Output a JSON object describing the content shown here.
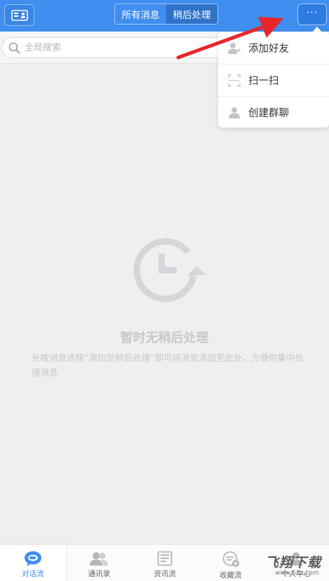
{
  "header": {
    "segments": [
      "所有消息",
      "稍后处理"
    ],
    "active_segment": "稍后处理",
    "more_label": "···"
  },
  "search": {
    "placeholder": "全局搜索"
  },
  "dropdown_menu": {
    "items": [
      {
        "label": "添加好友",
        "icon": "add-user-icon"
      },
      {
        "label": "扫一扫",
        "icon": "scan-icon"
      },
      {
        "label": "创建群聊",
        "icon": "group-chat-icon"
      }
    ]
  },
  "empty_state": {
    "icon": "clock-later-icon",
    "title": "暂时无稍后处理",
    "description": "长按消息选择“添加至稍后处理”即可将消息添加至此处，方便你集中处理消息"
  },
  "tabbar": {
    "active": "对话流",
    "items": [
      {
        "label": "对话流",
        "icon": "chat-bubble-icon"
      },
      {
        "label": "通讯录",
        "icon": "contacts-icon"
      },
      {
        "label": "资讯流",
        "icon": "news-icon"
      },
      {
        "label": "收藏流",
        "icon": "favorites-icon"
      },
      {
        "label": "个人中心",
        "icon": "profile-icon"
      }
    ]
  },
  "watermark": {
    "brand": "飞翔下载",
    "url": "www.52z.com"
  },
  "colors": {
    "accent": "#3f8ef0",
    "arrow": "#e8262a"
  }
}
